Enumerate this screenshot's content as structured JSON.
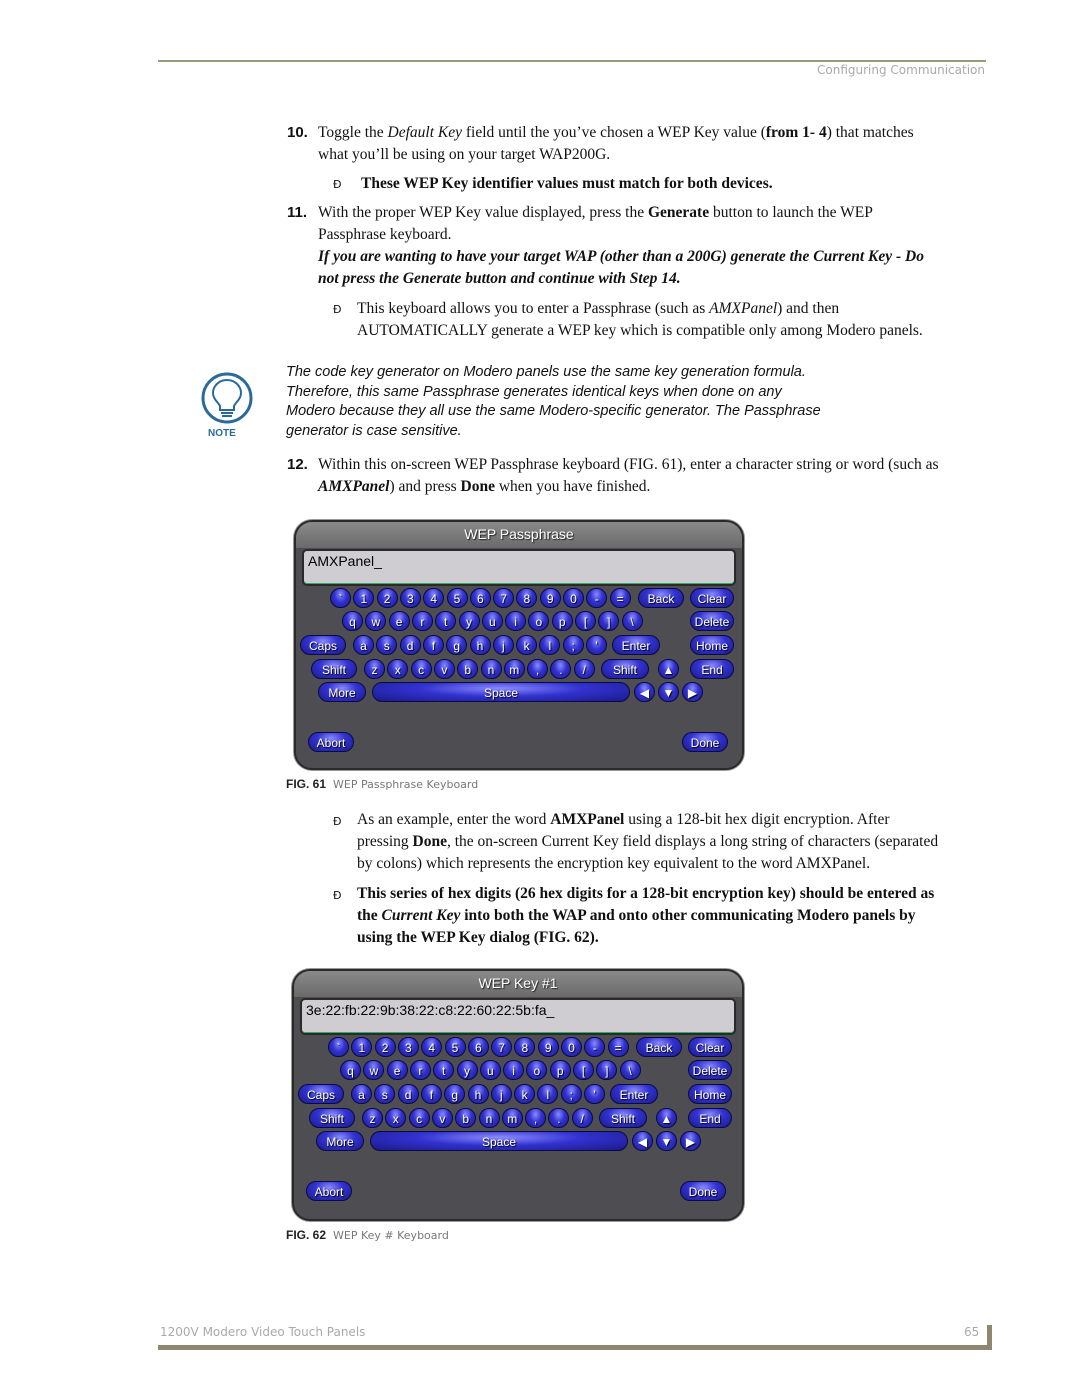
{
  "header": {
    "section_title": "Configuring Communication"
  },
  "steps": {
    "s10": {
      "number": "10.",
      "text_a": "Toggle the ",
      "italic_a": "Default Key",
      "text_b": " field until the you’ve chosen a WEP Key value (",
      "bold_a": "from 1- 4",
      "text_c": ") that matches",
      "line2": "what you’ll be using on your target WAP200G."
    },
    "s10_bullet": "These WEP Key identifier values must match for both devices.",
    "s11": {
      "number": "11.",
      "text_a": "With the proper WEP Key value displayed, press the ",
      "bold_a": "Generate",
      "text_b": " button to launch the WEP",
      "line2": "Passphrase keyboard."
    },
    "s11_warning_l1": "If you are wanting to have your target WAP (other than a 200G) generate the Current Key - Do",
    "s11_warning_l2": "not press the Generate button and continue with Step 14.",
    "s11_bullet": {
      "text_a": "This keyboard allows you to enter a Passphrase (such as ",
      "italic_a": "AMXPanel",
      "text_b": ") and then",
      "line2": "AUTOMATICALLY generate a WEP key which is compatible only among Modero panels."
    },
    "s12": {
      "number": "12.",
      "text_a": "Within this on-screen WEP Passphrase keyboard (FIG. 61), enter a character string or word (such as",
      "italic_b": "AMXPanel",
      "text_b": ") and press ",
      "bold_b": "Done",
      "text_c": " when you have finished."
    }
  },
  "note": {
    "label": "NOTE",
    "lines": [
      "The code key generator on Modero panels use the same key generation formula.",
      "Therefore, this same Passphrase generates identical keys when done on any",
      "Modero because they all use the same Modero-specific generator. The Passphrase",
      "generator is case sensitive."
    ]
  },
  "bullet_symbol": "Ð",
  "after_fig61": {
    "b1_l1_a": "As an example, enter the word ",
    "b1_l1_bold": "AMXPanel",
    "b1_l1_b": " using a 128-bit hex digit encryption. After",
    "b1_l2_a": "pressing ",
    "b1_l2_bold": "Done",
    "b1_l2_b": ", the on-screen Current Key field displays a long string of characters (separated",
    "b1_l3": "by colons) which represents the encryption key equivalent to the word AMXPanel.",
    "b2_l1": "This series of hex digits (26 hex digits for a 128-bit encryption key) should be entered as",
    "b2_l2_a": "the ",
    "b2_l2_italic": "Current Key",
    "b2_l2_b": " into both the WAP and onto other communicating Modero panels by",
    "b2_l3": "using the WEP Key dialog (FIG. 62)."
  },
  "figures": [
    {
      "number": "FIG. 61",
      "caption": "WEP Passphrase Keyboard",
      "title": "WEP Passphrase",
      "field_value": "AMXPanel_"
    },
    {
      "number": "FIG. 62",
      "caption": "WEP Key # Keyboard",
      "title": "WEP Key #1",
      "field_value": "3e:22:fb:22:9b:38:22:c8:22:60:22:5b:fa_"
    }
  ],
  "keyboard": {
    "row1": [
      "`",
      "1",
      "2",
      "3",
      "4",
      "5",
      "6",
      "7",
      "8",
      "9",
      "0",
      "-",
      "="
    ],
    "row2": [
      "q",
      "w",
      "e",
      "r",
      "t",
      "y",
      "u",
      "i",
      "o",
      "p",
      "[",
      "]",
      "\\"
    ],
    "row3": [
      "a",
      "s",
      "d",
      "f",
      "g",
      "h",
      "j",
      "k",
      "l",
      ";",
      "'"
    ],
    "row4": [
      "z",
      "x",
      "c",
      "v",
      "b",
      "n",
      "m",
      ",",
      ".",
      "/"
    ],
    "labels": {
      "back": "Back",
      "clear": "Clear",
      "delete": "Delete",
      "caps": "Caps",
      "enter": "Enter",
      "home": "Home",
      "shift": "Shift",
      "end": "End",
      "more": "More",
      "space": "Space",
      "abort": "Abort",
      "done": "Done"
    },
    "arrows": {
      "up": "▲",
      "left": "◀",
      "down": "▼",
      "right": "▶"
    }
  },
  "footer": {
    "title": "1200V Modero Video Touch Panels",
    "page": "65"
  }
}
